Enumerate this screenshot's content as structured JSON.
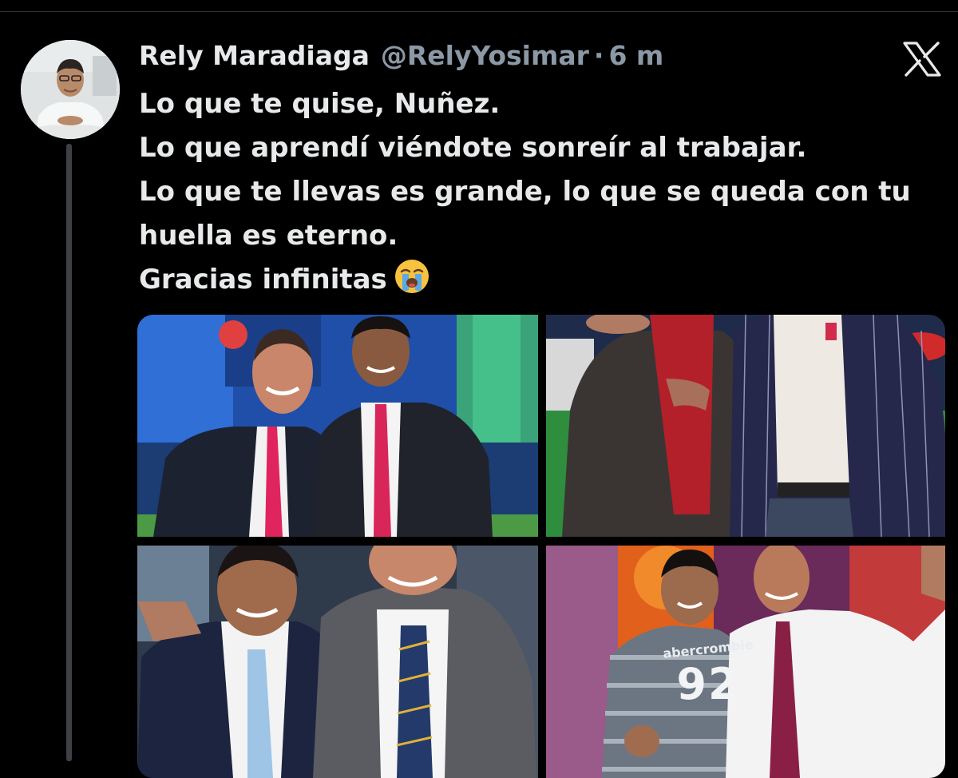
{
  "tweet": {
    "display_name": "Rely Maradiaga",
    "handle": "@RelyYosimar",
    "separator": "·",
    "time": "6 m",
    "lines": [
      "Lo que te quise, Nuñez.",
      "Lo que aprendí viéndote sonreír al trabajar.",
      "Lo que te llevas es grande, lo que se queda con tu",
      "huella es eterno.",
      "Gracias infinitas"
    ],
    "emoji": "loudly-crying-face"
  },
  "media": {
    "photos": [
      {
        "name": "photo-1"
      },
      {
        "name": "photo-2"
      },
      {
        "name": "photo-3"
      },
      {
        "name": "photo-4",
        "shirt_text": "abercrombie",
        "shirt_number": "92"
      }
    ]
  },
  "icons": {
    "brand": "x-logo",
    "avatar": "user-avatar"
  },
  "colors": {
    "background": "#000000",
    "text_primary": "#e7e9ea",
    "text_secondary": "#8b98a5",
    "thread_line": "#3d4044"
  }
}
